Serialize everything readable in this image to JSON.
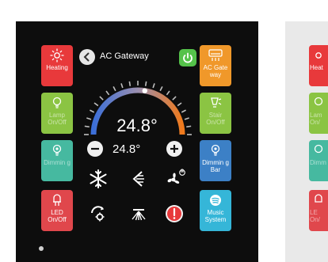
{
  "header": {
    "title": "AC Gateway"
  },
  "gauge": {
    "temperature": "24.8°",
    "level": 0.55
  },
  "setpoint": {
    "value": "24.8°"
  },
  "left_tiles": [
    {
      "label": "Heating",
      "color": "#e8393b",
      "icon": "sun-icon"
    },
    {
      "label": "Lamp On/Off",
      "color": "#8bc443",
      "icon": "bulb-icon"
    },
    {
      "label": "Dimmin g",
      "color": "#46b9a0",
      "icon": "bulb-icon"
    },
    {
      "label": "LED On/Off",
      "color": "#e0474c",
      "icon": "led-icon"
    }
  ],
  "right_tiles": [
    {
      "label": "AC Gate way",
      "color": "#f0982a",
      "icon": "ac-icon"
    },
    {
      "label": "Stair On/Off",
      "color": "#8bc443",
      "icon": "stair-light-icon"
    },
    {
      "label": "Dimmin g Bar",
      "color": "#3c80c6",
      "icon": "bulb-icon"
    },
    {
      "label": "Music System",
      "color": "#35b6d8",
      "icon": "music-icon"
    }
  ],
  "controls": {
    "row1": [
      "snowflake-icon",
      "swing-icon",
      "fan-icon"
    ],
    "row2": [
      "mode-icon",
      "vane-icon",
      "alert-icon"
    ],
    "fan_badge": "⊗"
  },
  "side_panel": {
    "tiles": [
      {
        "label": "Heat",
        "color": "#e8393b"
      },
      {
        "label": "Lam On/",
        "color": "#8bc443"
      },
      {
        "label": "Dimm",
        "color": "#46b9a0"
      },
      {
        "label": "LE On/",
        "color": "#e0474c"
      }
    ]
  }
}
